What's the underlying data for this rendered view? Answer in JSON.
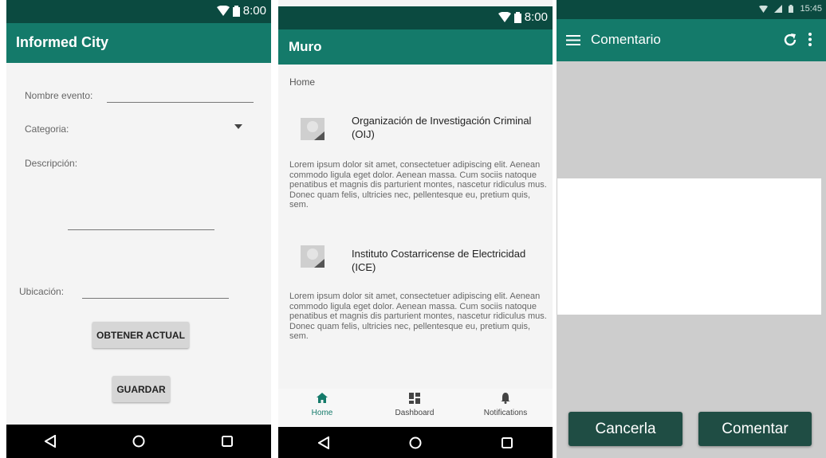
{
  "screen1": {
    "status_time": "8:00",
    "title": "Informed City",
    "nombre_label": "Nombre evento:",
    "categoria_label": "Categoria:",
    "descripcion_label": "Descripción:",
    "ubicacion_label": "Ubicación:",
    "obtener_button": "OBTENER ACTUAL",
    "guardar_button": "GUARDAR"
  },
  "screen2": {
    "status_time": "8:00",
    "title": "Muro",
    "section": "Home",
    "posts": [
      {
        "title": "Organización de Investigación Criminal (OIJ)",
        "body": "Lorem ipsum dolor sit amet, consectetuer adipiscing elit. Aenean commodo ligula eget dolor. Aenean massa. Cum sociis natoque penatibus et magnis dis parturient montes, nascetur ridiculus mus. Donec quam felis, ultricies nec, pellentesque eu, pretium quis, sem."
      },
      {
        "title": "Instituto Costarricense de Electricidad (ICE)",
        "body": "Lorem ipsum dolor sit amet, consectetuer adipiscing elit. Aenean commodo ligula eget dolor. Aenean massa. Cum sociis natoque penatibus et magnis dis parturient montes, nascetur ridiculus mus. Donec quam felis, ultricies nec, pellentesque eu, pretium quis, sem."
      }
    ],
    "tabs": [
      {
        "label": "Home",
        "icon": "home-icon"
      },
      {
        "label": "Dashboard",
        "icon": "dashboard-icon"
      },
      {
        "label": "Notifications",
        "icon": "bell-icon"
      }
    ],
    "accent": "#147a6a"
  },
  "screen3": {
    "status_time": "15:45",
    "title": "Comentario",
    "cancel_button": "Cancerla",
    "comment_button": "Comentar"
  },
  "colors": {
    "primary": "#147a6a",
    "primary_dark": "#0b4a40",
    "button_dark": "#1f4d44"
  }
}
